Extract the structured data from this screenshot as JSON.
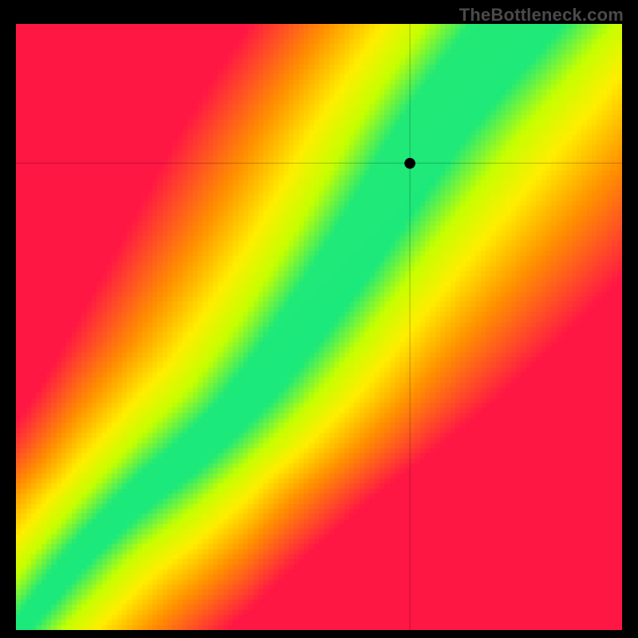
{
  "watermark": "TheBottleneck.com",
  "chart_data": {
    "type": "heatmap",
    "title": "",
    "xlabel": "",
    "ylabel": "",
    "xlim": [
      0,
      100
    ],
    "ylim": [
      0,
      100
    ],
    "grid": false,
    "legend": false,
    "point": {
      "x": 65,
      "y": 77
    },
    "crosshair": {
      "x": 65,
      "y": 77
    },
    "colorscale": [
      {
        "stop": 0.0,
        "color": "#ff1744"
      },
      {
        "stop": 0.35,
        "color": "#ff9100"
      },
      {
        "stop": 0.6,
        "color": "#ffee00"
      },
      {
        "stop": 0.78,
        "color": "#c6ff00"
      },
      {
        "stop": 1.0,
        "color": "#00e58f"
      }
    ],
    "ridge_curve_description": "Green optimal ridge runs roughly from bottom-left (0,0) to upper-right, with an S/J shape: steep through the lower-left, bowing right around the middle, then angling up toward the top-right corner.",
    "ridge_samples": [
      {
        "x": 2,
        "y": 2
      },
      {
        "x": 10,
        "y": 12
      },
      {
        "x": 20,
        "y": 22
      },
      {
        "x": 30,
        "y": 30
      },
      {
        "x": 38,
        "y": 38
      },
      {
        "x": 45,
        "y": 47
      },
      {
        "x": 52,
        "y": 57
      },
      {
        "x": 58,
        "y": 66
      },
      {
        "x": 63,
        "y": 74
      },
      {
        "x": 68,
        "y": 82
      },
      {
        "x": 74,
        "y": 90
      },
      {
        "x": 80,
        "y": 97
      }
    ],
    "resolution": 120
  }
}
